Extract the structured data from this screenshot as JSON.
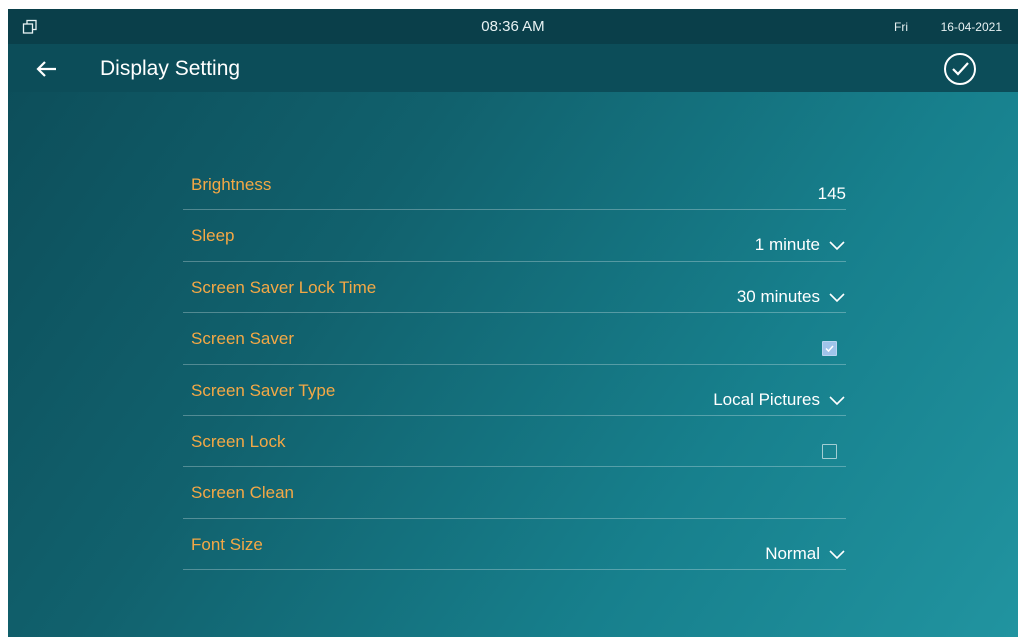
{
  "status": {
    "time": "08:36 AM",
    "day": "Fri",
    "date": "16-04-2021"
  },
  "header": {
    "title": "Display Setting"
  },
  "settings": {
    "brightness": {
      "label": "Brightness",
      "value": "145"
    },
    "sleep": {
      "label": "Sleep",
      "value": "1 minute"
    },
    "lock_time": {
      "label": "Screen Saver Lock Time",
      "value": "30 minutes"
    },
    "screen_saver": {
      "label": "Screen Saver",
      "checked": true
    },
    "saver_type": {
      "label": "Screen Saver Type",
      "value": "Local Pictures"
    },
    "screen_lock": {
      "label": "Screen Lock",
      "checked": false
    },
    "screen_clean": {
      "label": "Screen Clean"
    },
    "font_size": {
      "label": "Font Size",
      "value": "Normal"
    }
  },
  "colors": {
    "label": "#f4a845",
    "value": "#ffffff",
    "statusbar": "#0a3f4a"
  },
  "icons": [
    "window-restore-icon",
    "back-arrow-icon",
    "check-circle-icon",
    "chevron-down-icon",
    "checkmark-icon"
  ]
}
